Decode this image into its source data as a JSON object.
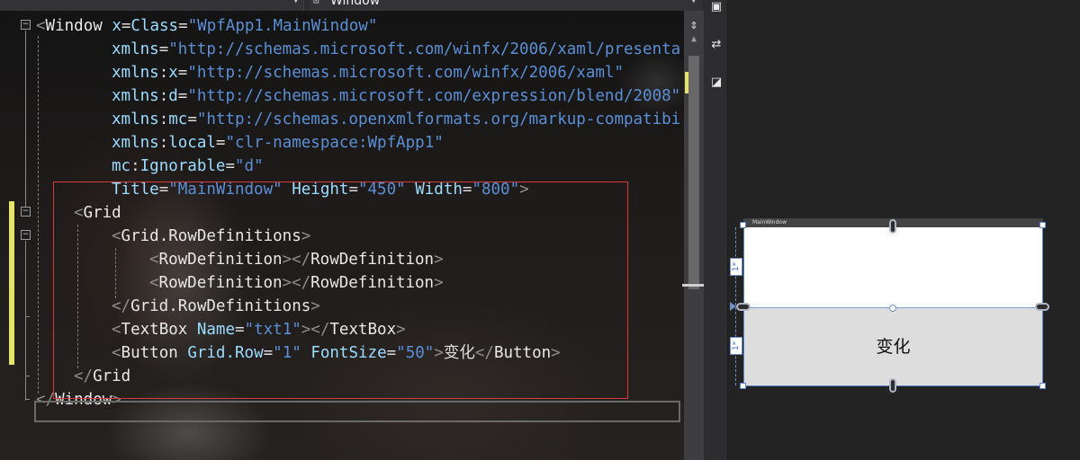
{
  "top_bar": {
    "element_dropdown_text": "Window",
    "element_dropdown_icon": "window-element-icon"
  },
  "code": {
    "lines": [
      [
        [
          "bracket",
          "<"
        ],
        [
          "elem",
          "Window "
        ],
        [
          "attr",
          "x"
        ],
        [
          "tk",
          "="
        ],
        [
          "attr",
          "Class"
        ],
        [
          "text",
          "="
        ],
        [
          "val",
          "\"WpfApp1.MainWindow\""
        ]
      ],
      [
        [
          "attr",
          "xmlns"
        ],
        [
          "text",
          "="
        ],
        [
          "val",
          "\"http://schemas.microsoft.com/winfx/2006/xaml/presenta"
        ]
      ],
      [
        [
          "attr",
          "xmlns"
        ],
        [
          "text",
          ":"
        ],
        [
          "attr",
          "x"
        ],
        [
          "text",
          "="
        ],
        [
          "val",
          "\"http://schemas.microsoft.com/winfx/2006/xaml\""
        ]
      ],
      [
        [
          "attr",
          "xmlns"
        ],
        [
          "text",
          ":"
        ],
        [
          "attr",
          "d"
        ],
        [
          "text",
          "="
        ],
        [
          "val",
          "\"http://schemas.microsoft.com/expression/blend/2008\""
        ]
      ],
      [
        [
          "attr",
          "xmlns"
        ],
        [
          "text",
          ":"
        ],
        [
          "attr",
          "mc"
        ],
        [
          "text",
          "="
        ],
        [
          "val",
          "\"http://schemas.openxmlformats.org/markup-compatibi"
        ]
      ],
      [
        [
          "attr",
          "xmlns"
        ],
        [
          "text",
          ":"
        ],
        [
          "attr",
          "local"
        ],
        [
          "text",
          "="
        ],
        [
          "val",
          "\"clr-namespace:WpfApp1\""
        ]
      ],
      [
        [
          "attr",
          "mc"
        ],
        [
          "text",
          ":"
        ],
        [
          "attr",
          "Ignorable"
        ],
        [
          "text",
          "="
        ],
        [
          "val",
          "\"d\""
        ]
      ],
      [
        [
          "attr",
          "Title"
        ],
        [
          "text",
          "="
        ],
        [
          "val",
          "\"MainWindow\""
        ],
        [
          "text",
          " "
        ],
        [
          "attr",
          "Height"
        ],
        [
          "text",
          "="
        ],
        [
          "val",
          "\"450\""
        ],
        [
          "text",
          " "
        ],
        [
          "attr",
          "Width"
        ],
        [
          "text",
          "="
        ],
        [
          "val",
          "\"800\""
        ],
        [
          "bracket",
          ">"
        ]
      ],
      [
        [
          "bracket",
          "<"
        ],
        [
          "elem",
          "Grid"
        ]
      ],
      [
        [
          "bracket",
          "<"
        ],
        [
          "elem",
          "Grid.RowDefinitions"
        ],
        [
          "bracket",
          ">"
        ]
      ],
      [
        [
          "bracket",
          "<"
        ],
        [
          "elem",
          "RowDefinition"
        ],
        [
          "bracket",
          "></"
        ],
        [
          "elem",
          "RowDefinition"
        ],
        [
          "bracket",
          ">"
        ]
      ],
      [
        [
          "bracket",
          "<"
        ],
        [
          "elem",
          "RowDefinition"
        ],
        [
          "bracket",
          "></"
        ],
        [
          "elem",
          "RowDefinition"
        ],
        [
          "bracket",
          ">"
        ]
      ],
      [
        [
          "bracket",
          "</"
        ],
        [
          "elem",
          "Grid.RowDefinitions"
        ],
        [
          "bracket",
          ">"
        ]
      ],
      [
        [
          "bracket",
          "<"
        ],
        [
          "elem",
          "TextBox "
        ],
        [
          "attr",
          "Name"
        ],
        [
          "text",
          "="
        ],
        [
          "val",
          "\"txt1\""
        ],
        [
          "bracket",
          "></"
        ],
        [
          "elem",
          "TextBox"
        ],
        [
          "bracket",
          ">"
        ]
      ],
      [
        [
          "bracket",
          "<"
        ],
        [
          "elem",
          "Button "
        ],
        [
          "attr",
          "Grid.Row"
        ],
        [
          "text",
          "="
        ],
        [
          "val",
          "\"1\""
        ],
        [
          "text",
          " "
        ],
        [
          "attr",
          "FontSize"
        ],
        [
          "text",
          "="
        ],
        [
          "val",
          "\"50\""
        ],
        [
          "bracket",
          ">"
        ],
        [
          "text",
          "变化"
        ],
        [
          "bracket",
          "</"
        ],
        [
          "elem",
          "Button"
        ],
        [
          "bracket",
          ">"
        ]
      ],
      [
        [
          "bracket",
          "</"
        ],
        [
          "elem",
          "Grid"
        ]
      ],
      [
        [
          "bracket",
          "</"
        ],
        [
          "elem",
          "Window"
        ],
        [
          "bracket",
          ">"
        ]
      ]
    ],
    "indents": [
      0,
      8,
      8,
      8,
      8,
      8,
      8,
      8,
      4,
      8,
      12,
      12,
      8,
      8,
      8,
      4,
      0
    ],
    "collapse_symbol": "−"
  },
  "designer": {
    "window_title": "MainWindow",
    "button_text": "变化",
    "row_size_1": "1*",
    "row_size_2": "1*"
  },
  "colors": {
    "accent": "#5d87c9",
    "highlight_rect": "#d63a3a",
    "change_marker": "#e6e36b"
  }
}
